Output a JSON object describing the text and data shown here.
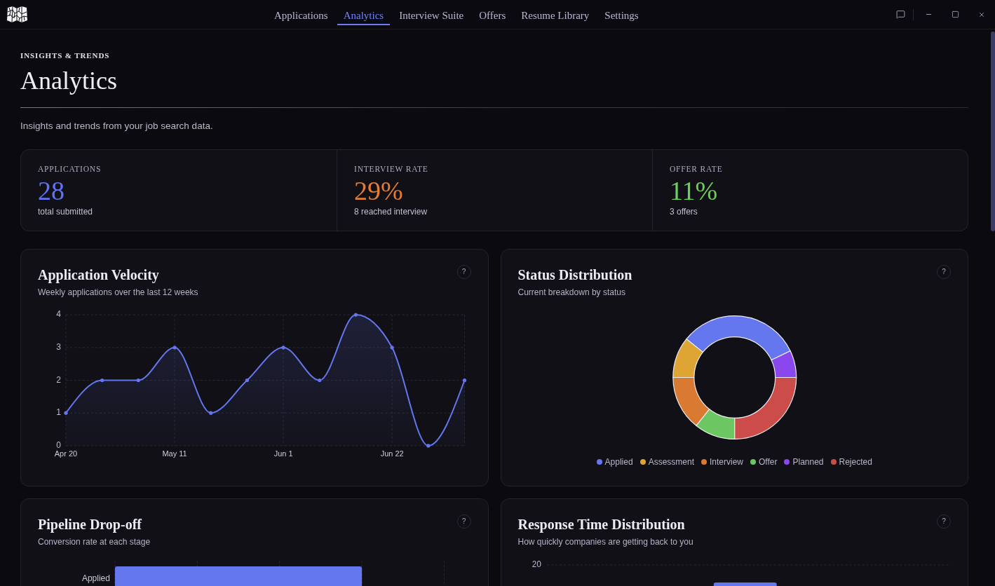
{
  "titlebar": {
    "tabs": [
      {
        "label": "Applications",
        "selected": false
      },
      {
        "label": "Analytics",
        "selected": true
      },
      {
        "label": "Interview Suite",
        "selected": false
      },
      {
        "label": "Offers",
        "selected": false
      },
      {
        "label": "Resume Library",
        "selected": false
      },
      {
        "label": "Settings",
        "selected": false
      }
    ]
  },
  "header": {
    "eyebrow": "INSIGHTS & TRENDS",
    "title": "Analytics",
    "subtitle": "Insights and trends from your job search data."
  },
  "stats": [
    {
      "label": "APPLICATIONS",
      "value": "28",
      "caption": "total submitted",
      "color": "#6173f2"
    },
    {
      "label": "INTERVIEW RATE",
      "value": "29%",
      "caption": "8 reached interview",
      "color": "#e27c36"
    },
    {
      "label": "OFFER RATE",
      "value": "11%",
      "caption": "3 offers",
      "color": "#6fcd5e"
    }
  ],
  "cards": [
    {
      "kind": "chart",
      "title": "Application Velocity",
      "subtitle": "Weekly applications over the last 12 weeks",
      "help": "?",
      "chart_data": {
        "type": "area",
        "categories": [
          "Apr 20",
          null,
          null,
          "May 11",
          null,
          null,
          "Jun 1",
          null,
          null,
          "Jun 22",
          null,
          null
        ],
        "ylim": [
          0,
          4
        ],
        "yticks": [
          0,
          1,
          2,
          3,
          4
        ],
        "grid": true,
        "series": [
          {
            "color": "#6577ee",
            "values": [
              1,
              2,
              2,
              3,
              1,
              2,
              3,
              2,
              4,
              3,
              0,
              2
            ]
          }
        ]
      }
    },
    {
      "kind": "chart",
      "title": "Status Distribution",
      "subtitle": "Current breakdown by status",
      "help": "?",
      "chart_data": {
        "type": "donut",
        "categories": [
          "Planned",
          "Applied",
          "Assessment",
          "Interview",
          "Offer",
          "Rejected"
        ],
        "values": [
          7.1,
          32.2,
          10.7,
          14.3,
          10.7,
          25
        ],
        "colors": [
          "#8a47ee",
          "#6577ee",
          "#dea434",
          "#da7931",
          "#6cc661",
          "#cc4c4a"
        ]
      }
    },
    {
      "kind": "bar-rows",
      "title": "Pipeline Drop-off",
      "subtitle": "Conversion rate at each stage",
      "help": "?",
      "row_labels": [
        "Applied"
      ]
    },
    {
      "kind": "columns",
      "title": "Response Time Distribution",
      "subtitle": "How quickly companies are getting back to you",
      "help": "?",
      "axis_labels": [
        "20"
      ]
    }
  ]
}
